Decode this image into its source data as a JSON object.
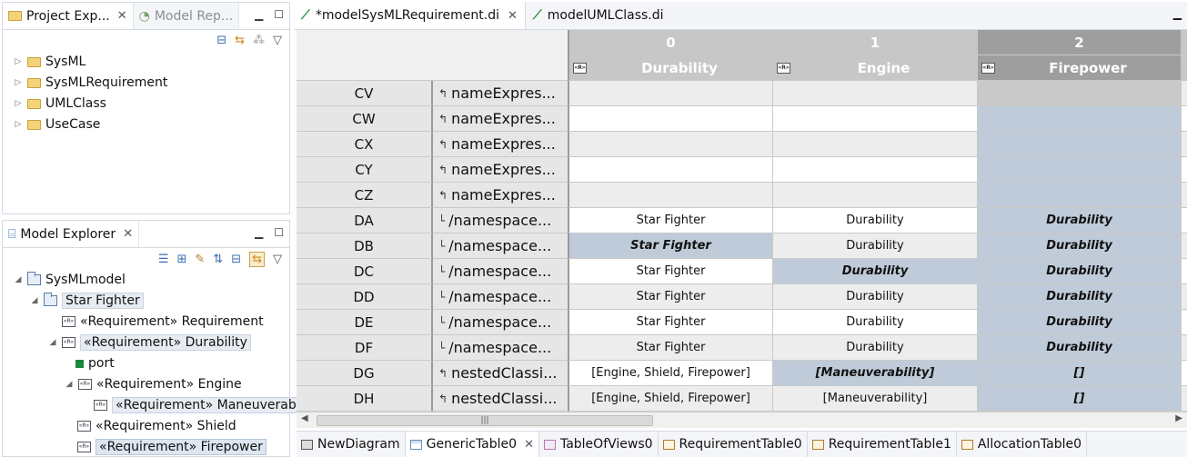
{
  "project_explorer": {
    "tabs": [
      "Project Exp...",
      "Model Rep..."
    ],
    "items": [
      "SysML",
      "SysMLRequirement",
      "UMLClass",
      "UseCase"
    ]
  },
  "model_explorer": {
    "title": "Model Explorer",
    "tree": [
      {
        "label": "SysMLmodel",
        "level": 0
      },
      {
        "label": "Star Fighter",
        "level": 1
      },
      {
        "label": "«Requirement» Requirement",
        "level": 2
      },
      {
        "label": "«Requirement» Durability",
        "level": 2
      },
      {
        "label": "port",
        "level": 3
      },
      {
        "label": "«Requirement» Engine",
        "level": 3
      },
      {
        "label": "«Requirement» Maneuverabi",
        "level": 4
      },
      {
        "label": "«Requirement» Shield",
        "level": 3
      },
      {
        "label": "«Requirement» Firepower",
        "level": 3
      }
    ]
  },
  "editor_tabs": [
    "*modelSysMLRequirement.di",
    "modelUMLClass.di"
  ],
  "table": {
    "columns": [
      {
        "index": "0",
        "name": "Durability"
      },
      {
        "index": "1",
        "name": "Engine"
      },
      {
        "index": "2",
        "name": "Firepower"
      }
    ],
    "rows": [
      {
        "id": "CV",
        "feature": "nameExpres...",
        "icon": "↰",
        "cells": [
          "",
          "",
          ""
        ]
      },
      {
        "id": "CW",
        "feature": "nameExpres...",
        "icon": "↰",
        "cells": [
          "",
          "",
          ""
        ]
      },
      {
        "id": "CX",
        "feature": "nameExpres...",
        "icon": "↰",
        "cells": [
          "",
          "",
          ""
        ]
      },
      {
        "id": "CY",
        "feature": "nameExpres...",
        "icon": "↰",
        "cells": [
          "",
          "",
          ""
        ]
      },
      {
        "id": "CZ",
        "feature": "nameExpres...",
        "icon": "↰",
        "cells": [
          "",
          "",
          ""
        ]
      },
      {
        "id": "DA",
        "feature": "/namespace...",
        "icon": "└",
        "cells": [
          "Star Fighter",
          "Durability",
          "Durability"
        ]
      },
      {
        "id": "DB",
        "feature": "/namespace...",
        "icon": "└",
        "cells": [
          "Star Fighter",
          "Durability",
          "Durability"
        ]
      },
      {
        "id": "DC",
        "feature": "/namespace...",
        "icon": "└",
        "cells": [
          "Star Fighter",
          "Durability",
          "Durability"
        ]
      },
      {
        "id": "DD",
        "feature": "/namespace...",
        "icon": "└",
        "cells": [
          "Star Fighter",
          "Durability",
          "Durability"
        ]
      },
      {
        "id": "DE",
        "feature": "/namespace...",
        "icon": "└",
        "cells": [
          "Star Fighter",
          "Durability",
          "Durability"
        ]
      },
      {
        "id": "DF",
        "feature": "/namespace...",
        "icon": "└",
        "cells": [
          "Star Fighter",
          "Durability",
          "Durability"
        ]
      },
      {
        "id": "DG",
        "feature": "nestedClassi...",
        "icon": "↰",
        "cells": [
          "[Engine, Shield, Firepower]",
          "[Maneuverability]",
          "[]"
        ]
      },
      {
        "id": "DH",
        "feature": "nestedClassi...",
        "icon": "↰",
        "cells": [
          "[Engine, Shield, Firepower]",
          "[Maneuverability]",
          "[]"
        ]
      }
    ]
  },
  "bottom_tabs": [
    "NewDiagram",
    "GenericTable0",
    "TableOfViews0",
    "RequirementTable0",
    "RequirementTable1",
    "AllocationTable0"
  ],
  "colors": {
    "selected_column": "#bfcbd9",
    "header": "#c7c7c7",
    "row_header": "#e6e6e6"
  }
}
